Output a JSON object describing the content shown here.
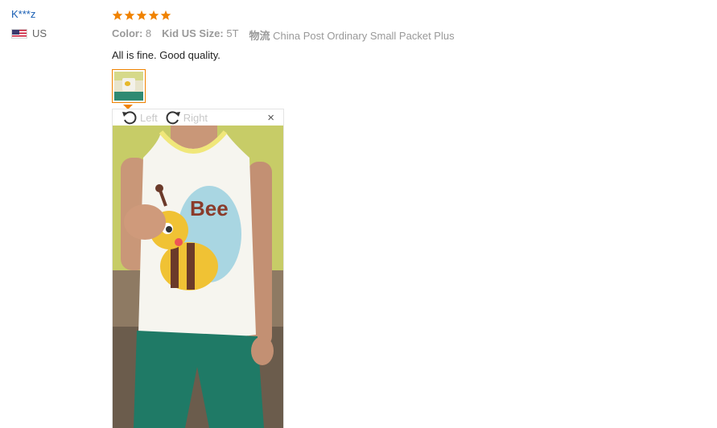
{
  "reviewer": {
    "name": "K***z",
    "country": "US",
    "flag_icon": "us-flag-icon"
  },
  "review": {
    "rating": 5,
    "star_color": "#f08200",
    "attributes": [
      {
        "label": "Color:",
        "value": "8"
      },
      {
        "label": "Kid US Size:",
        "value": "5T"
      },
      {
        "label": "物流",
        "value": "China Post Ordinary Small Packet Plus"
      }
    ],
    "text": "All is fine. Good quality."
  },
  "viewer": {
    "rotate_left_label": "Left",
    "rotate_right_label": "Right",
    "close_symbol": "×",
    "rotate_left_icon": "rotate-left-icon",
    "rotate_right_icon": "rotate-right-icon",
    "shirt_print_text": "Bee",
    "accent_color": "#f08200"
  }
}
